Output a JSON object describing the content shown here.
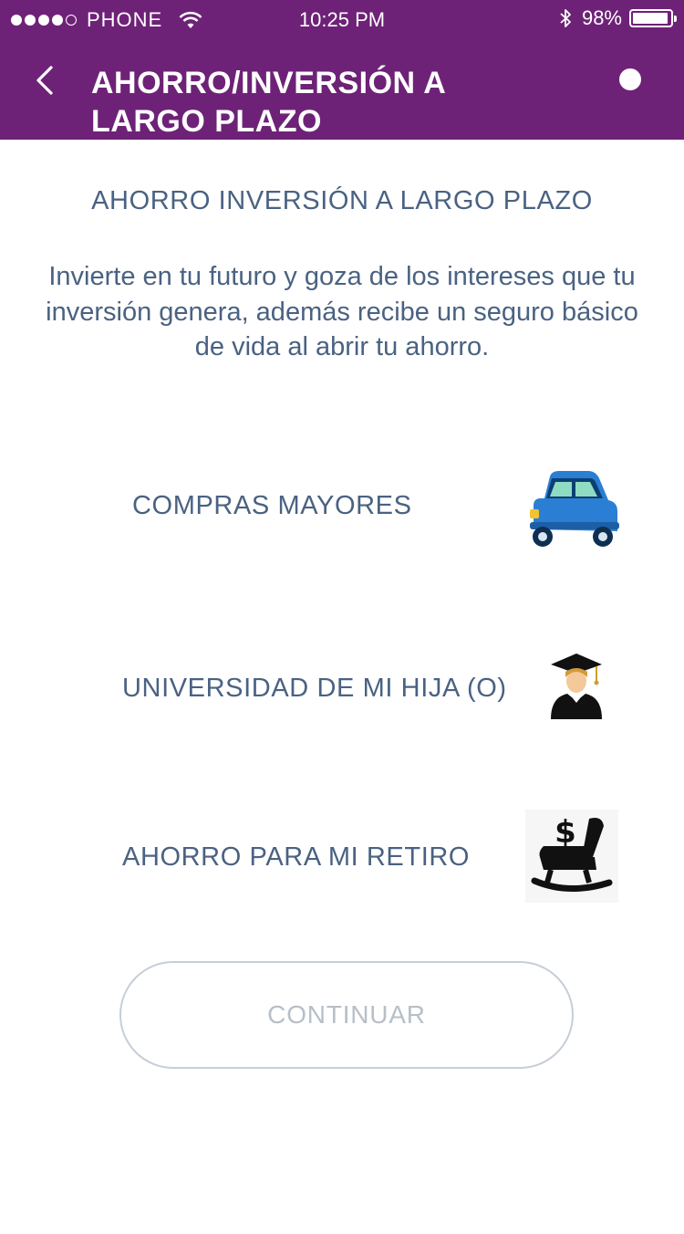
{
  "status_bar": {
    "carrier": "PHONE",
    "time": "10:25 PM",
    "battery": "98%",
    "signal_dots_filled": 4,
    "signal_dots_total": 5
  },
  "nav": {
    "title": "AHORRO/INVERSIÓN A LARGO PLAZO",
    "back_icon": "chevron-left-icon",
    "menu_icon": "circle-dot-icon"
  },
  "content": {
    "heading": "AHORRO INVERSIÓN A LARGO PLAZO",
    "description": "Invierte en tu futuro y goza de los intereses que tu inversión genera, además recibe un seguro básico de vida al abrir tu ahorro."
  },
  "options": [
    {
      "label": "COMPRAS MAYORES",
      "icon": "car-icon"
    },
    {
      "label": "UNIVERSIDAD DE MI HIJA (O)",
      "icon": "graduate-icon"
    },
    {
      "label": "AHORRO PARA MI RETIRO",
      "icon": "rocking-chair-money-icon"
    }
  ],
  "continue_button": {
    "label": "CONTINUAR"
  },
  "colors": {
    "nav_background": "#6e2277",
    "text": "#4a6282",
    "button_border": "#c6ced7",
    "button_text": "#b7bfc8"
  }
}
